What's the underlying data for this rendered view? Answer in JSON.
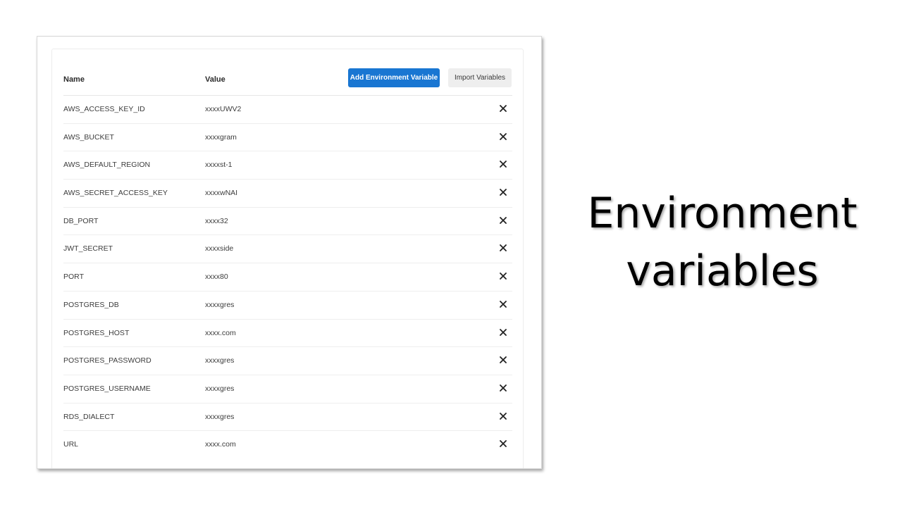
{
  "slide": {
    "title_line1": "Environment",
    "title_line2": "variables"
  },
  "table": {
    "header_name": "Name",
    "header_value": "Value",
    "add_button_label": "Add Environment Variable",
    "import_button_label": "Import Variables",
    "accent_color": "#1976d2",
    "delete_icon": "close-icon",
    "rows": [
      {
        "name": "AWS_ACCESS_KEY_ID",
        "value": "xxxxUWV2"
      },
      {
        "name": "AWS_BUCKET",
        "value": "xxxxgram"
      },
      {
        "name": "AWS_DEFAULT_REGION",
        "value": "xxxxst-1"
      },
      {
        "name": "AWS_SECRET_ACCESS_KEY",
        "value": "xxxxwNAI"
      },
      {
        "name": "DB_PORT",
        "value": "xxxx32"
      },
      {
        "name": "JWT_SECRET",
        "value": "xxxxside"
      },
      {
        "name": "PORT",
        "value": "xxxx80"
      },
      {
        "name": "POSTGRES_DB",
        "value": "xxxxgres"
      },
      {
        "name": "POSTGRES_HOST",
        "value": "xxxx.com"
      },
      {
        "name": "POSTGRES_PASSWORD",
        "value": "xxxxgres"
      },
      {
        "name": "POSTGRES_USERNAME",
        "value": "xxxxgres"
      },
      {
        "name": "RDS_DIALECT",
        "value": "xxxxgres"
      },
      {
        "name": "URL",
        "value": "xxxx.com"
      }
    ]
  }
}
